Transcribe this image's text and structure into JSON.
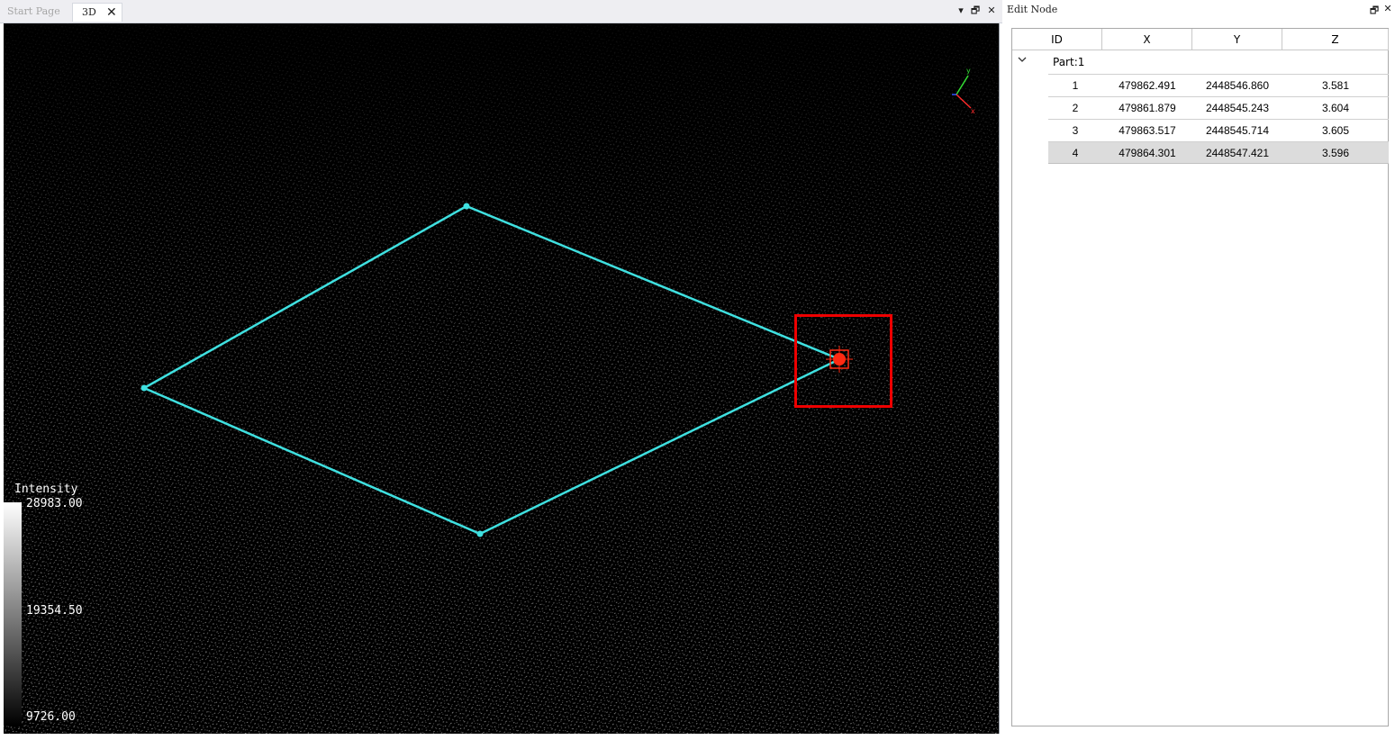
{
  "tabs": {
    "start_page": "Start Page",
    "view3d": "3D",
    "close_glyph": "✕"
  },
  "window_buttons": {
    "dropdown": "▾",
    "restore": "🗗",
    "close": "✕"
  },
  "legend": {
    "title": "Intensity",
    "max": "28983.00",
    "mid": "19354.50",
    "min": "9726.00"
  },
  "axes_gizmo": {
    "x_label": "x",
    "y_label": "y",
    "x_color": "#ff2a2a",
    "y_color": "#33dd33",
    "z_color": "#3355ff"
  },
  "polygon": {
    "line_color": "#3fe0e0",
    "selected_color": "#ff2a12",
    "highlight_box_color": "#ee0000"
  },
  "panel": {
    "title": "Edit Node",
    "restore_glyph": "🗗",
    "close_glyph": "✕",
    "columns": [
      "ID",
      "X",
      "Y",
      "Z"
    ],
    "group_label": "Part:1",
    "rows": [
      {
        "id": "1",
        "x": "479862.491",
        "y": "2448546.860",
        "z": "3.581"
      },
      {
        "id": "2",
        "x": "479861.879",
        "y": "2448545.243",
        "z": "3.604"
      },
      {
        "id": "3",
        "x": "479863.517",
        "y": "2448545.714",
        "z": "3.605"
      },
      {
        "id": "4",
        "x": "479864.301",
        "y": "2448547.421",
        "z": "3.596",
        "selected": true
      }
    ]
  }
}
